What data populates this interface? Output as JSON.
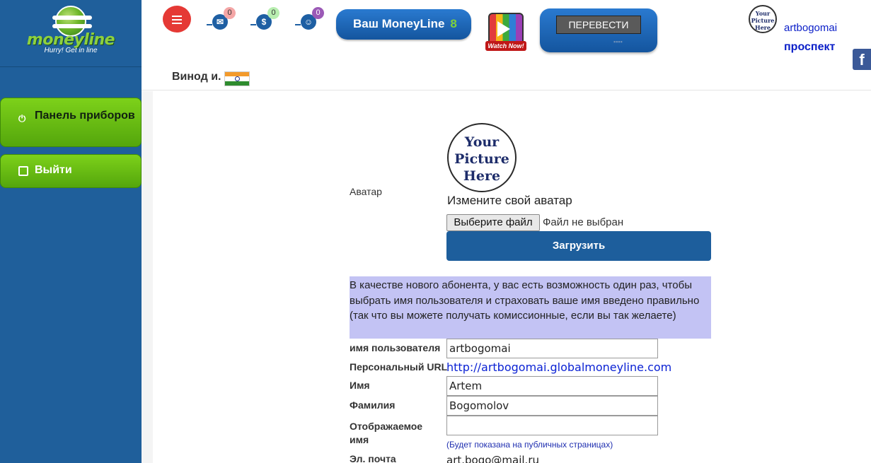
{
  "logo": {
    "name": "moneyline",
    "tagline": "Hurry! Get in line"
  },
  "sidebar": {
    "items": [
      {
        "label": "Панель приборов",
        "icon": "power-icon"
      },
      {
        "label": "Выйти",
        "icon": "logout-icon"
      }
    ]
  },
  "header": {
    "notifications": [
      {
        "icon": "mail-icon",
        "count": "0",
        "badge_color": "#f4a6a6"
      },
      {
        "icon": "money-bag-icon",
        "count": "0",
        "badge_color": "#b8eeb0"
      },
      {
        "icon": "users-icon",
        "count": "0",
        "badge_color": "#9b59b6"
      }
    ],
    "moneyline_label": "Ваш MoneyLine",
    "moneyline_count": "8",
    "watch_label": "Watch Now!",
    "translate_label": "ПЕРЕВЕСТИ",
    "username": "artbogomai",
    "prospect_label": "проспект",
    "facebook_letter": "f",
    "user_display": "Винод и.",
    "avatar_text": "Your Picture Here"
  },
  "profile": {
    "avatar_label": "Аватар",
    "avatar_text": "Your Picture Here",
    "change_avatar": "Измените свой аватар",
    "choose_file": "Выберите файл",
    "no_file": "Файл не выбран",
    "upload": "Загрузить",
    "info_text": "В качестве нового абонента, у вас есть возможность один раз, чтобы выбрать имя пользователя и страховать ваше имя введено правильно (так что вы можете получать комиссионные, если вы так желаете)",
    "fields": {
      "username_label": "имя пользователя",
      "username_value": "artbogomai",
      "url_label": "Персональный URL",
      "url_value": "http://artbogomai.globalmoneyline.com",
      "first_name_label": "Имя",
      "first_name_value": "Artem",
      "last_name_label": "Фамилия",
      "last_name_value": "Bogomolov",
      "display_name_label": "Отображаемое имя",
      "display_name_value": "",
      "display_note": "(Будет показана на публичных страницах)",
      "email_label": "Эл. почта",
      "email_value": "art.bogo@mail.ru"
    }
  },
  "colors": {
    "sidebar_bg": "#1f5f9b",
    "green_button": "#6cbf14",
    "brand_blue": "#1d5e9c",
    "menu_red": "#e53935",
    "info_bg": "#c3c3f4",
    "link_blue": "#0b22d4"
  }
}
